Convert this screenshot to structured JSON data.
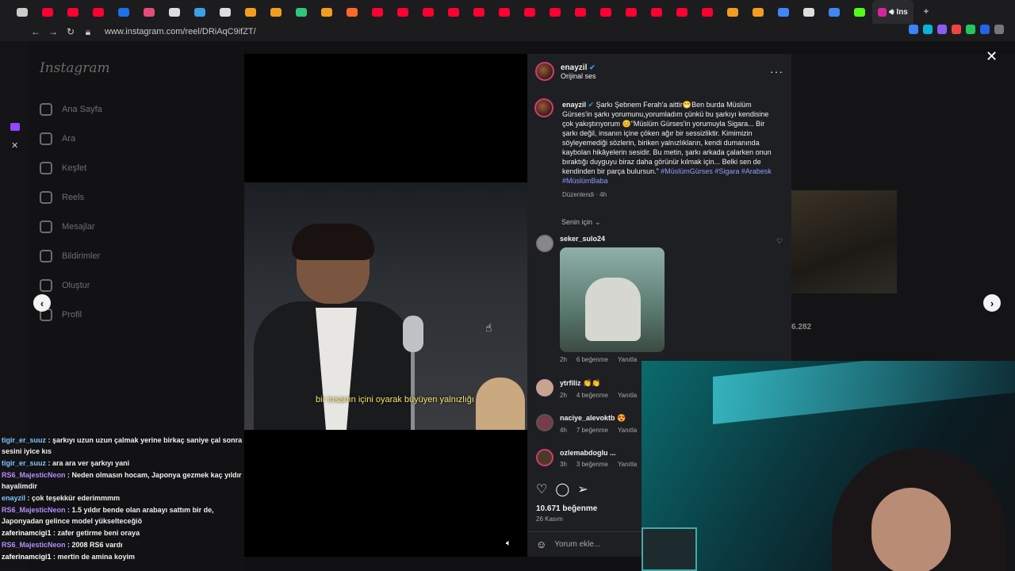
{
  "browser": {
    "url": "www.instagram.com/reel/DRiAqC9ifZT/",
    "active_tab_label": "Ins",
    "tabs": [
      {
        "icon": "mail-icon",
        "color": "#cccccc"
      },
      {
        "icon": "youtube-icon",
        "color": "#ff0033"
      },
      {
        "icon": "youtube-icon",
        "color": "#ff0033"
      },
      {
        "icon": "youtube-icon",
        "color": "#ff0033"
      },
      {
        "icon": "p-icon",
        "color": "#1f6feb"
      },
      {
        "icon": "app-icon",
        "color": "#e44d7b"
      },
      {
        "icon": "x-icon",
        "color": "#dddddd"
      },
      {
        "icon": "download-icon",
        "color": "#3aa0e8"
      },
      {
        "icon": "tt-icon",
        "color": "#dddddd"
      },
      {
        "icon": "game-icon",
        "color": "#f29d21"
      },
      {
        "icon": "game-icon",
        "color": "#f29d21"
      },
      {
        "icon": "bars-icon",
        "color": "#2dc67b"
      },
      {
        "icon": "game-icon",
        "color": "#f29d21"
      },
      {
        "icon": "app-icon",
        "color": "#ff6a2a"
      },
      {
        "icon": "youtube-icon",
        "color": "#ff0033"
      },
      {
        "icon": "youtube-icon",
        "color": "#ff0033"
      },
      {
        "icon": "youtube-icon",
        "color": "#ff0033"
      },
      {
        "icon": "youtube-icon",
        "color": "#ff0033"
      },
      {
        "icon": "youtube-icon",
        "color": "#ff0033"
      },
      {
        "icon": "youtube-icon",
        "color": "#ff0033"
      },
      {
        "icon": "youtube-icon",
        "color": "#ff0033"
      },
      {
        "icon": "youtube-icon",
        "color": "#ff0033"
      },
      {
        "icon": "youtube-icon",
        "color": "#ff0033"
      },
      {
        "icon": "youtube-icon",
        "color": "#ff0033"
      },
      {
        "icon": "youtube-icon",
        "color": "#ff0033"
      },
      {
        "icon": "youtube-icon",
        "color": "#ff0033"
      },
      {
        "icon": "youtube-icon",
        "color": "#ff0033"
      },
      {
        "icon": "youtube-icon",
        "color": "#ff0033"
      },
      {
        "icon": "game-icon",
        "color": "#f29d21"
      },
      {
        "icon": "game-icon",
        "color": "#f29d21"
      },
      {
        "icon": "google-icon",
        "color": "#4285f4"
      },
      {
        "icon": "tiktok-icon",
        "color": "#dddddd"
      },
      {
        "icon": "google-icon",
        "color": "#4285f4"
      },
      {
        "icon": "k-icon",
        "color": "#53fc18"
      }
    ]
  },
  "sidebar": {
    "logo": "Instagram",
    "items": [
      {
        "label": "Ana Sayfa",
        "icon": "home-icon"
      },
      {
        "label": "Ara",
        "icon": "search-icon"
      },
      {
        "label": "Keşfet",
        "icon": "compass-icon"
      },
      {
        "label": "Reels",
        "icon": "reels-icon"
      },
      {
        "label": "Mesajlar",
        "icon": "send-icon"
      },
      {
        "label": "Bildirimler",
        "icon": "heart-icon"
      },
      {
        "label": "Oluştur",
        "icon": "plus-icon"
      },
      {
        "label": "Profil",
        "icon": "profile-icon"
      }
    ]
  },
  "video": {
    "subtitle": "bir insanın içini oyarak büyüyen yalnızlığı"
  },
  "post": {
    "username": "enayzil",
    "audio": "Orijinal ses",
    "caption_user": "enayzil",
    "caption_text": "Şarkı Şebnem Ferah'a aittir😁Ben burda Müslüm Gürses'in şarkı yorumunu,yorumladım çünkü bu şarkıyı kendisine çok yakıştırıyorum 😊\"Müslüm Gürses'in yorumuyla Sigara... Bir şarkı değil, insanın içine çöken ağır bir sessizliktir. Kimimizin söyleyemediği sözlerin, biriken yalnızlıkların, kendi dumanında kaybolan hikâyelerin sesidir. Bu metin, şarkı arkada çalarken onun bıraktığı duyguyu biraz daha görünür kılmak için... Belki sen de kendinden bir parça bulursun.\"",
    "hashtags": "#MüslümGürses #Sigara #Arabesk #MüslümBaba",
    "edited": "Düzenlendi · 4h",
    "sort": "Senin için",
    "likes": "10.671 beğenme",
    "date": "26 Kasım",
    "comment_placeholder": "Yorum ekle..."
  },
  "comments": [
    {
      "user": "seker_sulo24",
      "text": "",
      "time": "2h",
      "likes": "6 beğenme",
      "reply": "Yanıtla"
    },
    {
      "user": "ytrfiliz",
      "text": "👏👏",
      "time": "2h",
      "likes": "4 beğenme",
      "reply": "Yanıtla"
    },
    {
      "user": "naciye_alevoktb",
      "text": "😍",
      "time": "4h",
      "likes": "7 beğenme",
      "reply": "Yanıtla"
    },
    {
      "user": "ozlemabdoglu ...",
      "text": "",
      "time": "3h",
      "likes": "3 beğenme",
      "reply": "Yanıtla"
    }
  ],
  "background": {
    "stat": "6.282"
  },
  "chat": [
    {
      "user": "tigir_er_suuz",
      "color": "#7ec4ff",
      "text": "şarkıyı uzun uzun çalmak yerine birkaç saniye çal sonra sesini iyice kıs"
    },
    {
      "user": "tigir_er_suuz",
      "color": "#7ec4ff",
      "text": "ara ara ver şarkıyı yani"
    },
    {
      "user": "RS6_MajesticNeon",
      "color": "#b38cff",
      "text": "Neden olmasın hocam, Japonya gezmek kaç yıldır hayalimdir"
    },
    {
      "user": "enayzil",
      "color": "#7ec4ff",
      "text": "çok teşekkür ederimmmm"
    },
    {
      "user": "RS6_MajesticNeon",
      "color": "#b38cff",
      "text": "1.5 yıldır bende olan arabayı sattım bir de, Japonyadan gelince model yükselteceğiö"
    },
    {
      "user": "zaferinamcigi1",
      "color": "#ffffff",
      "text": "zafer getirme beni oraya"
    },
    {
      "user": "RS6_MajesticNeon",
      "color": "#b38cff",
      "text": "2008 RS6 vardı"
    },
    {
      "user": "zaferinamcigi1",
      "color": "#ffffff",
      "text": "mertin de amina koyim"
    }
  ]
}
